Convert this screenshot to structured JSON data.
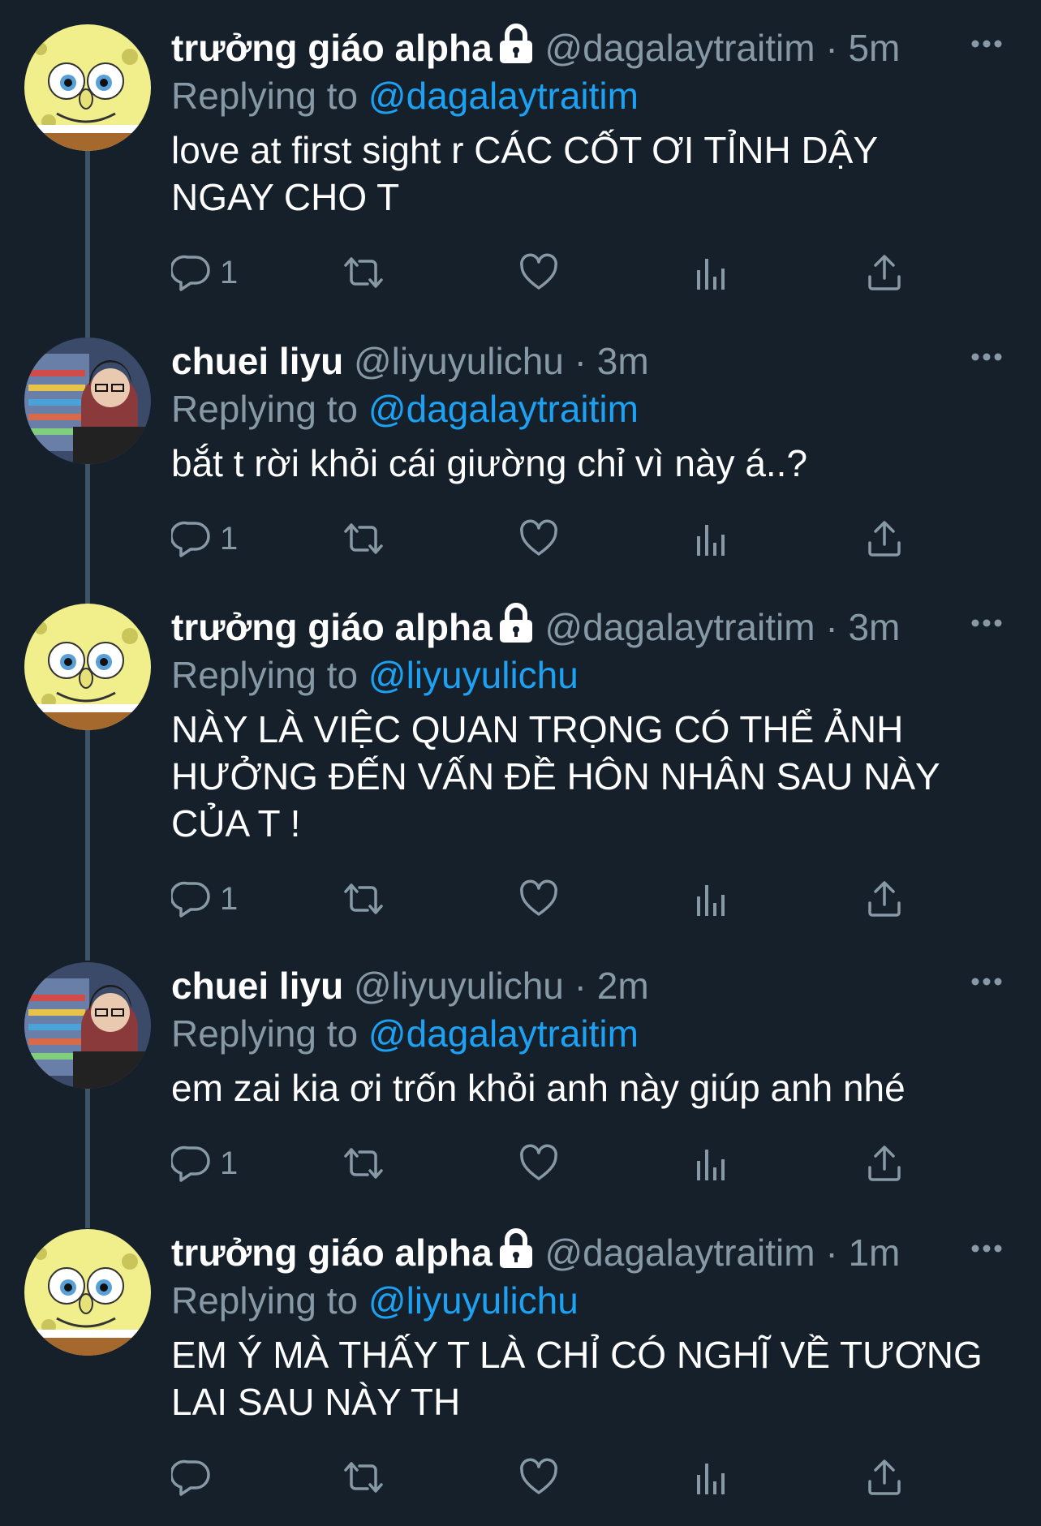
{
  "tweets": [
    {
      "author": "trưởng giáo alpha",
      "locked": true,
      "handle": "@dagalaytraitim",
      "dot": "·",
      "time": "5m",
      "replying_label": "Replying to",
      "replying_to": "@dagalaytraitim",
      "text": "love at first sight r CÁC CỐT ƠI TỈNH DẬY\nNGAY CHO T",
      "reply_count": "1",
      "avatar_icon": "spongebob-avatar"
    },
    {
      "author": "chuei liyu",
      "locked": false,
      "handle": "@liyuyulichu",
      "dot": "·",
      "time": "3m",
      "replying_label": "Replying to",
      "replying_to": "@dagalaytraitim",
      "text": "bắt t rời khỏi cái giường chỉ vì này á..?",
      "reply_count": "1",
      "avatar_icon": "person-photo-avatar"
    },
    {
      "author": "trưởng giáo alpha",
      "locked": true,
      "handle": "@dagalaytraitim",
      "dot": "·",
      "time": "3m",
      "replying_label": "Replying to",
      "replying_to": "@liyuyulichu",
      "text": "NÀY LÀ VIỆC QUAN TRỌNG CÓ THỂ ẢNH\nHƯỞNG ĐẾN VẤN ĐỀ HÔN NHÂN SAU NÀY\nCỦA T !",
      "reply_count": "1",
      "avatar_icon": "spongebob-avatar"
    },
    {
      "author": "chuei liyu",
      "locked": false,
      "handle": "@liyuyulichu",
      "dot": "·",
      "time": "2m",
      "replying_label": "Replying to",
      "replying_to": "@dagalaytraitim",
      "text": "em zai kia ơi trốn khỏi anh này giúp anh nhé",
      "reply_count": "1",
      "avatar_icon": "person-photo-avatar"
    },
    {
      "author": "trưởng giáo alpha",
      "locked": true,
      "handle": "@dagalaytraitim",
      "dot": "·",
      "time": "1m",
      "replying_label": "Replying to",
      "replying_to": "@liyuyulichu",
      "text": "EM Ý MÀ THẤY T LÀ CHỈ CÓ NGHĨ VỀ TƯƠNG\nLAI SAU NÀY TH",
      "reply_count": "",
      "avatar_icon": "spongebob-avatar"
    }
  ],
  "colors": {
    "background": "#15202b",
    "secondary_text": "#8899a6",
    "link": "#1da1f2",
    "thread_line": "#3d5466"
  }
}
